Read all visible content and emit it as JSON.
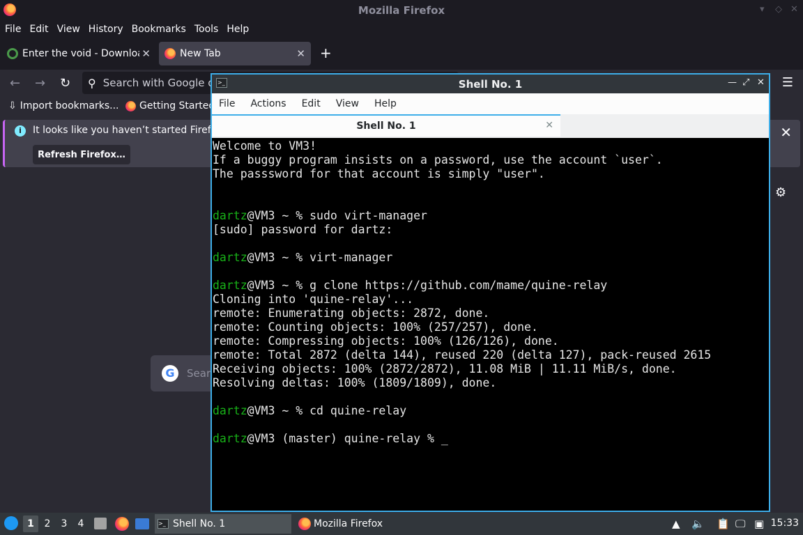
{
  "firefox": {
    "window_title": "Mozilla Firefox",
    "menu": [
      "File",
      "Edit",
      "View",
      "History",
      "Bookmarks",
      "Tools",
      "Help"
    ],
    "tabs": [
      {
        "title": "Enter the void - Downloa",
        "icon": "void-linux-icon"
      },
      {
        "title": "New Tab",
        "icon": "firefox-icon"
      }
    ],
    "new_tab_symbol": "+",
    "urlbar_placeholder": "Search with Google o",
    "bookmarks": [
      {
        "label": "Import bookmarks...",
        "icon": "import-icon"
      },
      {
        "label": "Getting Started",
        "icon": "firefox-icon"
      }
    ],
    "notification": {
      "message": "It looks like you haven’t started Firefox",
      "button": "Refresh Firefox…"
    },
    "content_search_hint": "Searc"
  },
  "shell": {
    "window_title": "Shell No. 1",
    "menu": [
      "File",
      "Actions",
      "Edit",
      "View",
      "Help"
    ],
    "tab_title": "Shell No. 1",
    "terminal_lines": [
      {
        "text": "Welcome to VM3!"
      },
      {
        "text": "If a buggy program insists on a password, use the account `user`."
      },
      {
        "text": "The passsword for that account is simply \"user\"."
      },
      {
        "text": ""
      },
      {
        "text": ""
      },
      {
        "user": "dartz",
        "text": "@VM3 ~ % sudo virt-manager"
      },
      {
        "text": "[sudo] password for dartz:"
      },
      {
        "text": ""
      },
      {
        "user": "dartz",
        "text": "@VM3 ~ % virt-manager"
      },
      {
        "text": ""
      },
      {
        "user": "dartz",
        "text": "@VM3 ~ % g clone https://github.com/mame/quine-relay"
      },
      {
        "text": "Cloning into 'quine-relay'..."
      },
      {
        "text": "remote: Enumerating objects: 2872, done."
      },
      {
        "text": "remote: Counting objects: 100% (257/257), done."
      },
      {
        "text": "remote: Compressing objects: 100% (126/126), done."
      },
      {
        "text": "remote: Total 2872 (delta 144), reused 220 (delta 127), pack-reused 2615"
      },
      {
        "text": "Receiving objects: 100% (2872/2872), 11.08 MiB | 11.11 MiB/s, done."
      },
      {
        "text": "Resolving deltas: 100% (1809/1809), done."
      },
      {
        "text": ""
      },
      {
        "user": "dartz",
        "text": "@VM3 ~ % cd quine-relay"
      },
      {
        "text": ""
      },
      {
        "user": "dartz",
        "text": "@VM3 (master) quine-relay % _"
      }
    ],
    "colors": {
      "prompt_user": "#18b218",
      "text": "#e7e7e7",
      "background": "#000000",
      "focus_border": "#3daee9"
    }
  },
  "taskbar": {
    "desktops": [
      "1",
      "2",
      "3",
      "4"
    ],
    "tasks": [
      {
        "label": "Shell No. 1",
        "icon": "terminal-icon"
      },
      {
        "label": "Mozilla Firefox",
        "icon": "firefox-icon"
      }
    ],
    "clock": "15:33"
  }
}
